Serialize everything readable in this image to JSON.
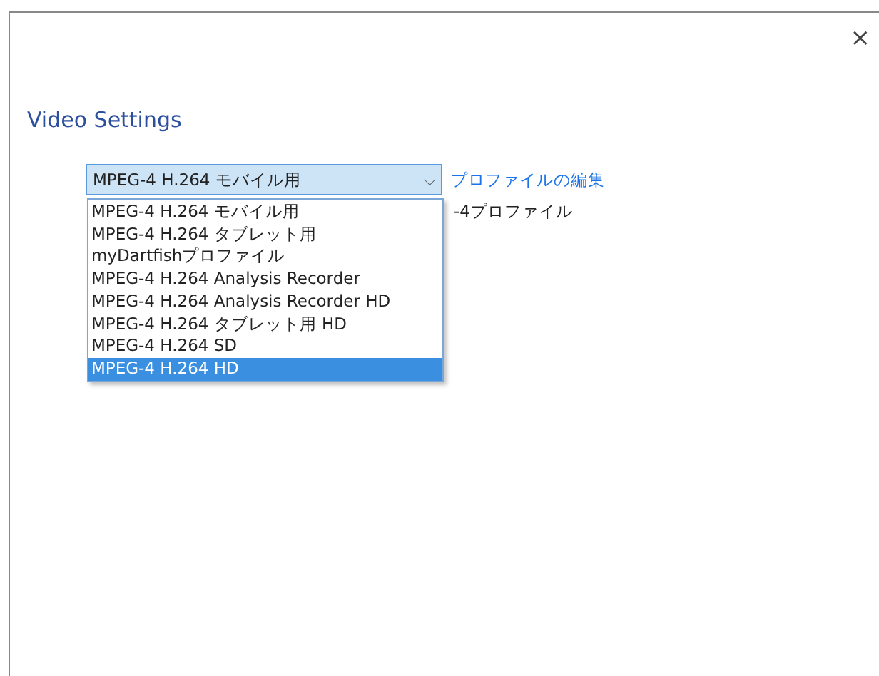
{
  "window": {
    "close": "×"
  },
  "title": "Video Settings",
  "profile_select": {
    "value": "MPEG-4 H.264 モバイル用",
    "caret": "⌵",
    "edit_link": "プロファイルの編集",
    "partial_label": "-4プロファイル",
    "options": [
      {
        "label": "MPEG-4 H.264 モバイル用",
        "highlighted": false
      },
      {
        "label": "MPEG-4 H.264 タブレット用",
        "highlighted": false
      },
      {
        "label": "myDartfishプロファイル",
        "highlighted": false
      },
      {
        "label": "MPEG-4 H.264 Analysis Recorder",
        "highlighted": false
      },
      {
        "label": "MPEG-4 H.264 Analysis Recorder HD",
        "highlighted": false
      },
      {
        "label": "MPEG-4 H.264 タブレット用 HD",
        "highlighted": false
      },
      {
        "label": "MPEG-4 H.264 SD",
        "highlighted": false
      },
      {
        "label": "MPEG-4 H.264 HD",
        "highlighted": true
      }
    ]
  }
}
